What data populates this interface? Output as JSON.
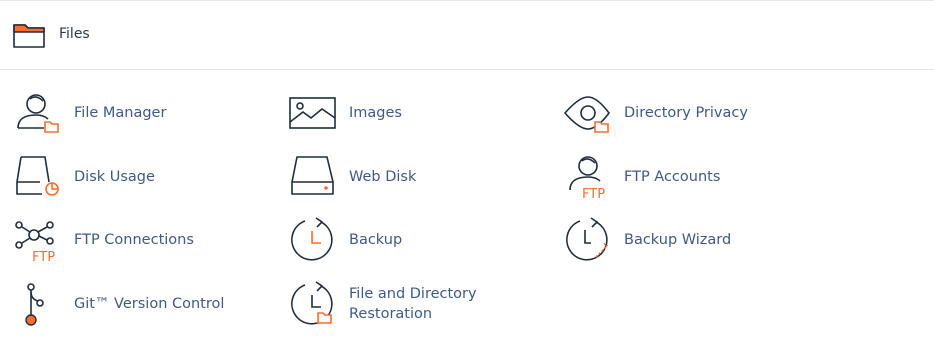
{
  "section": {
    "title": "Files",
    "icon": "folder-icon"
  },
  "colors": {
    "text": "#293a4a",
    "link": "#3d5a89",
    "accent": "#ff6c2c",
    "icon_stroke": "#1f2d3d"
  },
  "items": [
    {
      "label": "File Manager",
      "icon": "file-manager-icon"
    },
    {
      "label": "Images",
      "icon": "images-icon"
    },
    {
      "label": "Directory Privacy",
      "icon": "directory-privacy-icon"
    },
    {
      "label": "Disk Usage",
      "icon": "disk-usage-icon"
    },
    {
      "label": "Web Disk",
      "icon": "web-disk-icon"
    },
    {
      "label": "FTP Accounts",
      "icon": "ftp-accounts-icon"
    },
    {
      "label": "FTP Connections",
      "icon": "ftp-connections-icon"
    },
    {
      "label": "Backup",
      "icon": "backup-icon"
    },
    {
      "label": "Backup Wizard",
      "icon": "backup-wizard-icon"
    },
    {
      "label": "Git™ Version Control",
      "icon": "git-icon"
    },
    {
      "label": "File and Directory\nRestoration",
      "icon": "file-restoration-icon"
    }
  ],
  "icon_text": {
    "ftp": "FTP"
  }
}
